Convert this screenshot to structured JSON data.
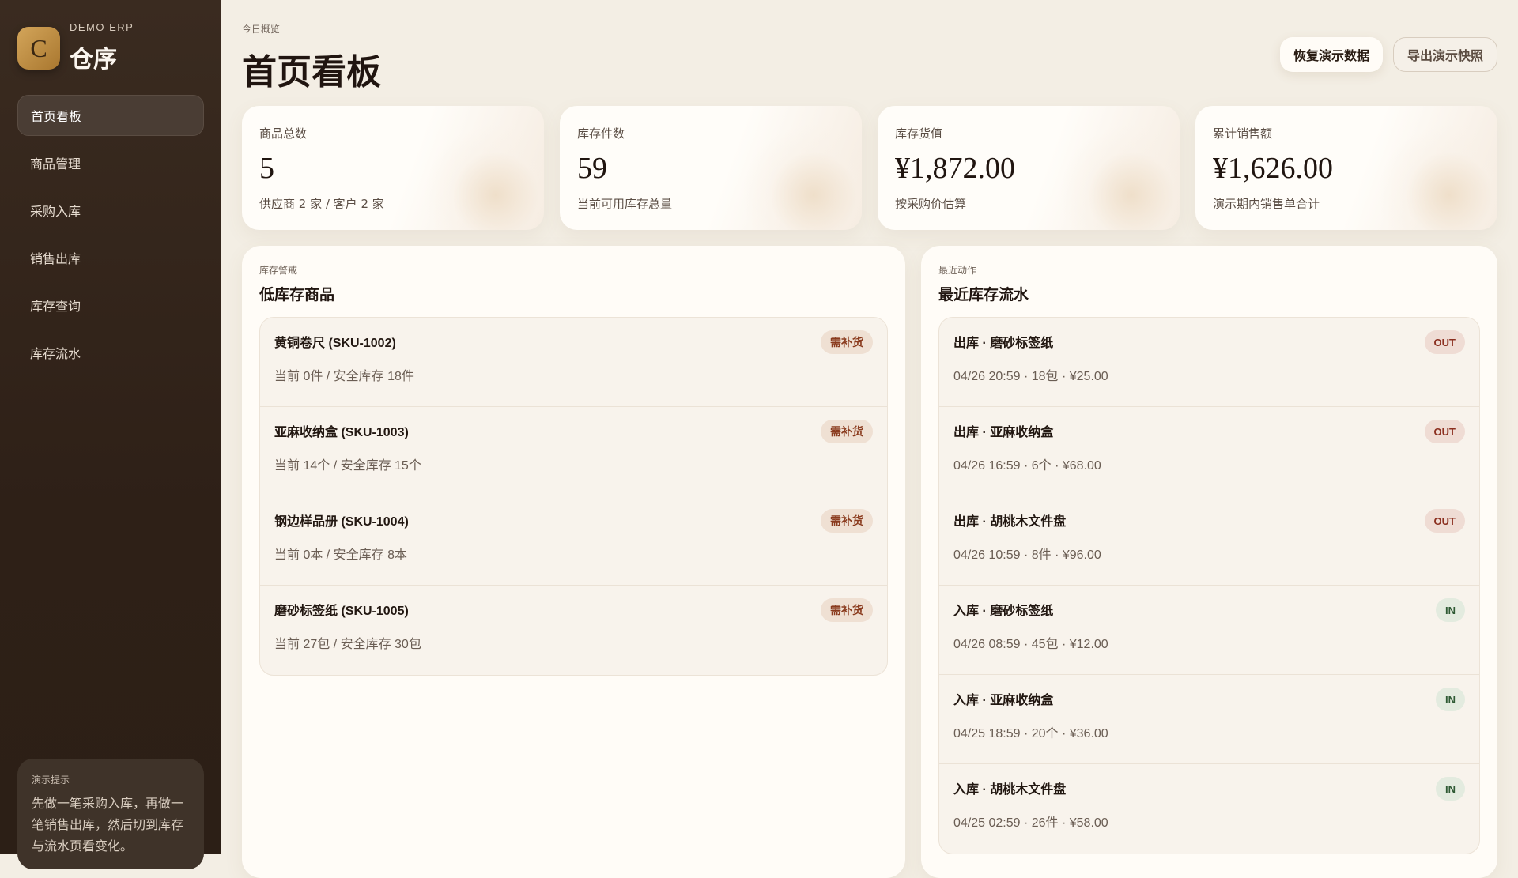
{
  "sidebar": {
    "logo_letter": "C",
    "brand_sub": "DEMO ERP",
    "brand": "仓序",
    "items": [
      {
        "label": "首页看板",
        "active": true
      },
      {
        "label": "商品管理"
      },
      {
        "label": "采购入库"
      },
      {
        "label": "销售出库"
      },
      {
        "label": "库存查询"
      },
      {
        "label": "库存流水"
      }
    ],
    "tip": {
      "title": "演示提示",
      "text": "先做一笔采购入库，再做一笔销售出库，然后切到库存与流水页看变化。"
    }
  },
  "header": {
    "eyebrow": "今日概览",
    "title": "首页看板",
    "restore_label": "恢复演示数据",
    "export_label": "导出演示快照"
  },
  "stats": [
    {
      "label": "商品总数",
      "value": "5",
      "sub": "供应商 2 家 / 客户 2 家"
    },
    {
      "label": "库存件数",
      "value": "59",
      "sub": "当前可用库存总量"
    },
    {
      "label": "库存货值",
      "value": "¥1,872.00",
      "sub": "按采购价估算"
    },
    {
      "label": "累计销售额",
      "value": "¥1,626.00",
      "sub": "演示期内销售单合计"
    }
  ],
  "low_stock": {
    "eyebrow": "库存警戒",
    "title": "低库存商品",
    "items": [
      {
        "name": "黄铜卷尺 (SKU-1002)",
        "detail": "当前 0件 / 安全库存 18件",
        "badge": "需补货"
      },
      {
        "name": "亚麻收纳盒 (SKU-1003)",
        "detail": "当前 14个 / 安全库存 15个",
        "badge": "需补货"
      },
      {
        "name": "钢边样品册 (SKU-1004)",
        "detail": "当前 0本 / 安全库存 8本",
        "badge": "需补货"
      },
      {
        "name": "磨砂标签纸 (SKU-1005)",
        "detail": "当前 27包 / 安全库存 30包",
        "badge": "需补货"
      }
    ]
  },
  "movements": {
    "eyebrow": "最近动作",
    "title": "最近库存流水",
    "items": [
      {
        "name": "出库 · 磨砂标签纸",
        "detail": "04/26 20:59 · 18包 · ¥25.00",
        "badge": "OUT"
      },
      {
        "name": "出库 · 亚麻收纳盒",
        "detail": "04/26 16:59 · 6个 · ¥68.00",
        "badge": "OUT"
      },
      {
        "name": "出库 · 胡桃木文件盘",
        "detail": "04/26 10:59 · 8件 · ¥96.00",
        "badge": "OUT"
      },
      {
        "name": "入库 · 磨砂标签纸",
        "detail": "04/26 08:59 · 45包 · ¥12.00",
        "badge": "IN"
      },
      {
        "name": "入库 · 亚麻收纳盒",
        "detail": "04/25 18:59 · 20个 · ¥36.00",
        "badge": "IN"
      },
      {
        "name": "入库 · 胡桃木文件盘",
        "detail": "04/25 02:59 · 26件 · ¥58.00",
        "badge": "IN"
      }
    ]
  }
}
